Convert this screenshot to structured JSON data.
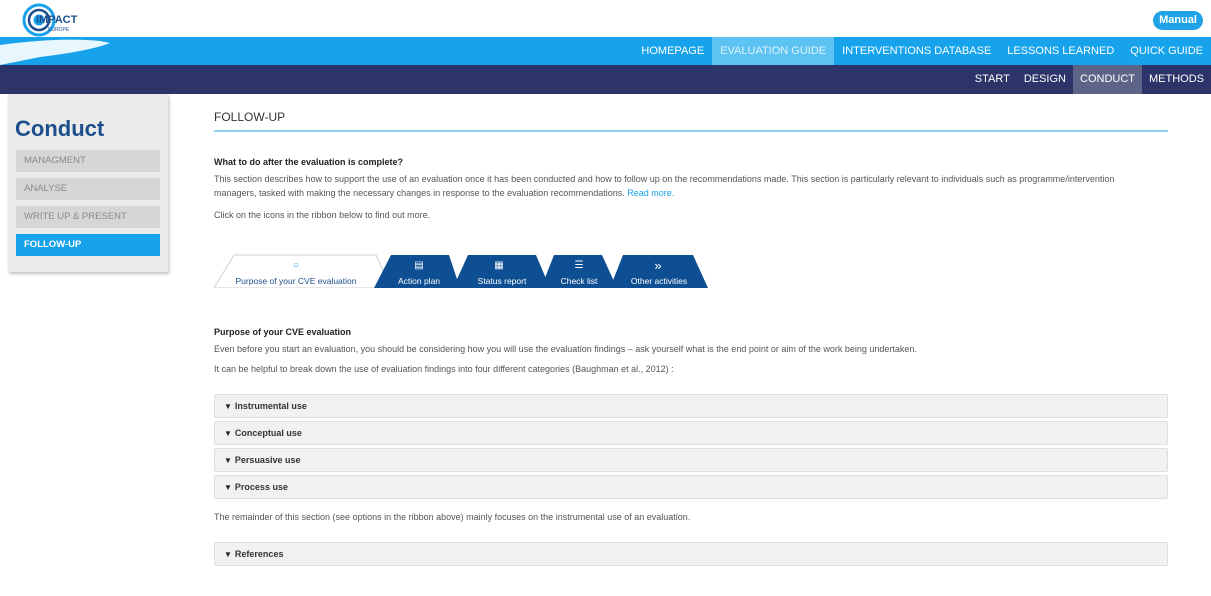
{
  "header": {
    "logo_text": "IMPACT",
    "logo_sub": "EUROPE",
    "manual_label": "Manual"
  },
  "mainnav": {
    "items": [
      "HOMEPAGE",
      "EVALUATION GUIDE",
      "INTERVENTIONS DATABASE",
      "LESSONS LEARNED",
      "QUICK GUIDE"
    ],
    "active": "EVALUATION GUIDE"
  },
  "subnav": {
    "items": [
      "START",
      "DESIGN",
      "CONDUCT",
      "METHODS"
    ],
    "active": "CONDUCT"
  },
  "sidebar": {
    "title": "Conduct",
    "items": [
      "MANAGMENT",
      "ANALYSE",
      "WRITE UP & PRESENT",
      "FOLLOW-UP"
    ],
    "active": "FOLLOW-UP"
  },
  "content": {
    "section_title": "FOLLOW-UP",
    "question": "What to do after the evaluation is complete?",
    "intro_line1": "This section describes how to support the use of an evaluation once it has been conducted and how to follow up on the recommendations made. This section is particularly relevant to individuals such as programme/intervention",
    "intro_line2": "managers, tasked with making the necessary changes in response to the evaluation recommendations.",
    "read_more": "Read more.",
    "click_hint": "Click on the icons in the ribbon below to find out more.",
    "ribbon": [
      {
        "label": "Purpose of your CVE evaluation",
        "icon": "circle-icon",
        "glyph": "○"
      },
      {
        "label": "Action plan",
        "icon": "clipboard-icon",
        "glyph": "▤"
      },
      {
        "label": "Status report",
        "icon": "report-icon",
        "glyph": "▦"
      },
      {
        "label": "Check list",
        "icon": "checklist-icon",
        "glyph": "☰"
      },
      {
        "label": "Other activities",
        "icon": "double-chevron-icon",
        "glyph": "»"
      }
    ],
    "purpose_heading": "Purpose of your CVE evaluation",
    "purpose_p1": "Even before you start an evaluation, you should be considering how you will use the evaluation findings – ask yourself what is the end point or aim of the work being undertaken.",
    "purpose_p2": "It can be helpful to break down the use of evaluation findings into four different categories (Baughman et al., 2012) :",
    "accordions": [
      "Instrumental use",
      "Conceptual use",
      "Persuasive use",
      "Process use"
    ],
    "remainder": "The remainder of this section (see options in the ribbon above) mainly focuses on the instrumental use of an evaluation.",
    "references": "References"
  },
  "colors": {
    "nav_blue": "#17a3eb",
    "nav_dark": "#2c3469",
    "title_blue": "#1d4f8c",
    "ribbon_blue": "#0d4f92"
  }
}
